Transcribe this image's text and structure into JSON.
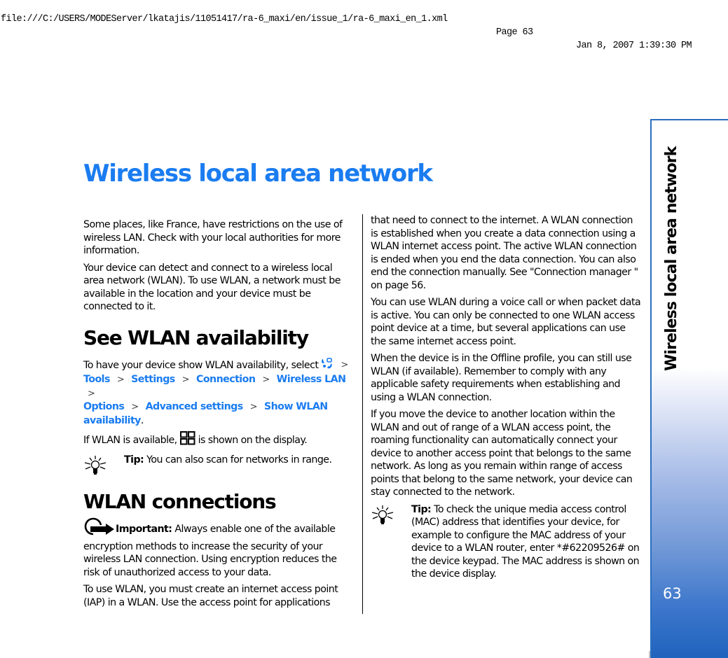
{
  "print_header": {
    "url": "file:///C:/USERS/MODEServer/lkatajis/11051417/ra-6_maxi/en/issue_1/ra-6_maxi_en_1.xml",
    "page": "Page 63",
    "datetime": "Jan 8, 2007 1:39:30 PM"
  },
  "chapter": {
    "title": "Wireless local area network",
    "side_title": "Wireless local area network",
    "page_number": "63"
  },
  "colors": {
    "accent": "#1a7cf0",
    "sidebar_border": "#2a6fbf",
    "sidebar_gradient_end": "#1f63be"
  },
  "left_column": {
    "intro_paragraphs": [
      "Some places, like France, have restrictions on the use of wireless LAN. Check with your local authorities for more information.",
      "Your device can detect and connect to a wireless local area network (WLAN). To use WLAN, a network must be available in the location and your device must be connected to it."
    ],
    "see_wlan": {
      "heading": "See WLAN availability",
      "instruction_prefix": "To have your device show WLAN availability, select",
      "menu_icon": "menu-key-icon",
      "separator": ">",
      "path": [
        "Tools",
        "Settings",
        "Connection",
        "Wireless LAN",
        "Options",
        "Advanced settings",
        "Show WLAN availability"
      ],
      "instruction_suffix": ".",
      "availability_prefix": "If WLAN is available,",
      "availability_icon": "wlan-available-icon",
      "availability_suffix": "is shown on the display.",
      "tip": {
        "icon": "lightbulb-icon",
        "label": "Tip:",
        "text": "You can also scan for networks in range."
      }
    },
    "wlan_connections": {
      "heading": "WLAN connections",
      "important": {
        "icon": "important-pointer-icon",
        "label": "Important:",
        "text": "Always enable one of the available encryption methods to increase the security of your wireless LAN connection. Using encryption reduces the risk of unauthorized access to your data."
      },
      "paragraph": "To use WLAN, you must create an internet access point (IAP) in a WLAN. Use the access point for applications"
    }
  },
  "right_column": {
    "paragraphs": [
      "that need to connect to the internet. A WLAN connection is established when you create a data connection using a WLAN internet access point. The active WLAN connection is ended when you end the data connection. You can also end the connection manually. See \"Connection manager \" on page 56.",
      "You can use WLAN during a voice call or when packet data is active. You can only be connected to one WLAN access point device at a time, but several applications can use the same internet access point.",
      "When the device is in the Offline profile, you can still use WLAN (if available). Remember to comply with any applicable safety requirements when establishing and using a WLAN connection.",
      "If you move the device to another location within the WLAN and out of range of a WLAN access point, the roaming functionality can automatically connect your device to another access point that belongs to the same network. As long as you remain within range of access points that belong to the same network, your device can stay connected to the network."
    ],
    "tip": {
      "icon": "lightbulb-icon",
      "label": "Tip:",
      "text": "To check the unique media access control (MAC) address that identifies your device, for example to configure the MAC address of your device to a WLAN router, enter *#62209526# on the device keypad. The MAC address is shown on the device display."
    }
  }
}
